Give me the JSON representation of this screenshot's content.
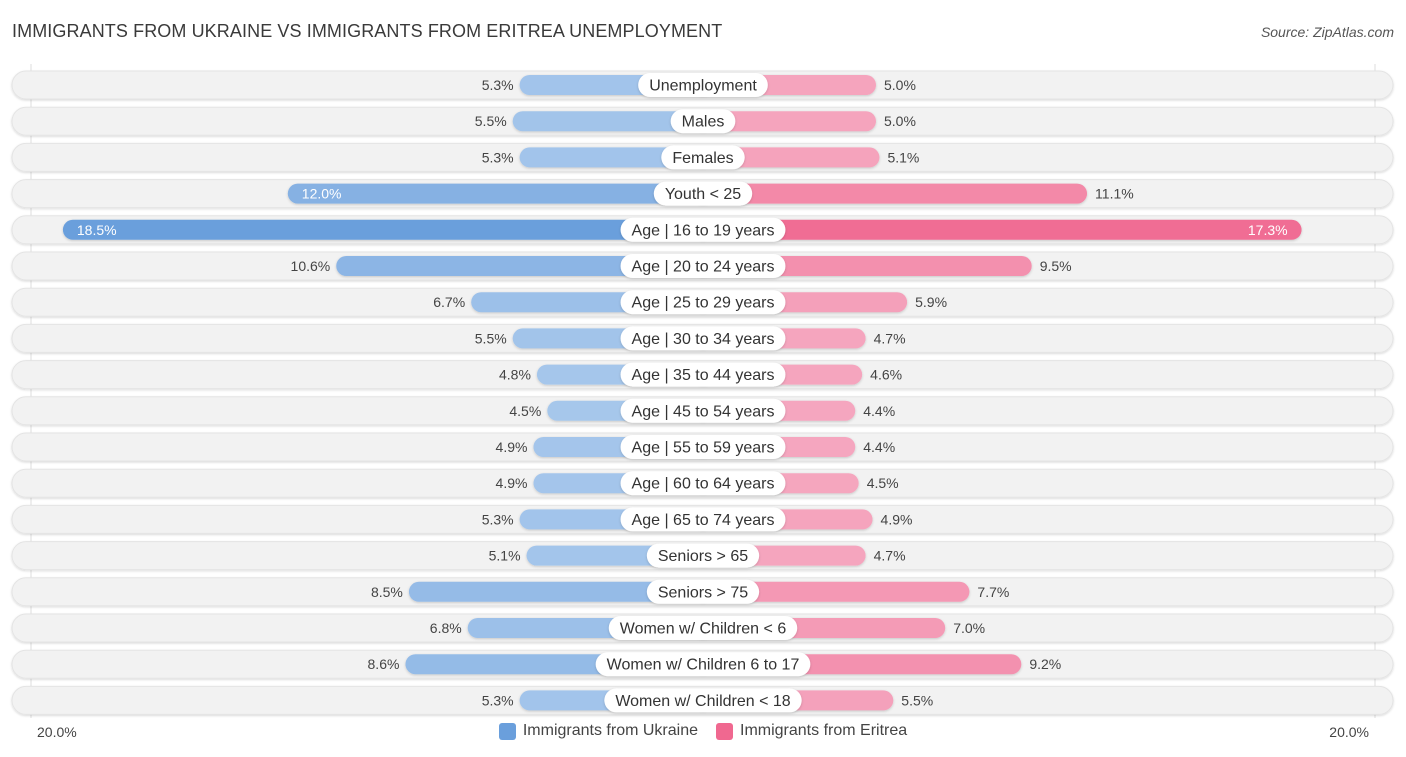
{
  "header": {
    "title": "IMMIGRANTS FROM UKRAINE VS IMMIGRANTS FROM ERITREA UNEMPLOYMENT",
    "source": "Source: ZipAtlas.com"
  },
  "colors": {
    "ukraine_light": "#a8c8ec",
    "ukraine_strong": "#6a9fdc",
    "eritrea_light": "#f5a8c0",
    "eritrea_strong": "#f06890",
    "track": "#f2f2f2"
  },
  "chart_data": {
    "type": "bar",
    "orientation": "horizontal-diverging",
    "title": "IMMIGRANTS FROM UKRAINE VS IMMIGRANTS FROM ERITREA UNEMPLOYMENT",
    "xlabel": "",
    "ylabel": "",
    "xlim": [
      -20.0,
      20.0
    ],
    "axis_labels": {
      "left": "20.0%",
      "right": "20.0%"
    },
    "legend_position": "bottom-center",
    "grid": false,
    "categories": [
      "Unemployment",
      "Males",
      "Females",
      "Youth < 25",
      "Age | 16 to 19 years",
      "Age | 20 to 24 years",
      "Age | 25 to 29 years",
      "Age | 30 to 34 years",
      "Age | 35 to 44 years",
      "Age | 45 to 54 years",
      "Age | 55 to 59 years",
      "Age | 60 to 64 years",
      "Age | 65 to 74 years",
      "Seniors > 65",
      "Seniors > 75",
      "Women w/ Children < 6",
      "Women w/ Children 6 to 17",
      "Women w/ Children < 18"
    ],
    "series": [
      {
        "name": "Immigrants from Ukraine",
        "side": "left",
        "values": [
          5.3,
          5.5,
          5.3,
          12.0,
          18.5,
          10.6,
          6.7,
          5.5,
          4.8,
          4.5,
          4.9,
          4.9,
          5.3,
          5.1,
          8.5,
          6.8,
          8.6,
          5.3
        ],
        "labels": [
          "5.3%",
          "5.5%",
          "5.3%",
          "12.0%",
          "18.5%",
          "10.6%",
          "6.7%",
          "5.5%",
          "4.8%",
          "4.5%",
          "4.9%",
          "4.9%",
          "5.3%",
          "5.1%",
          "8.5%",
          "6.8%",
          "8.6%",
          "5.3%"
        ]
      },
      {
        "name": "Immigrants from Eritrea",
        "side": "right",
        "values": [
          5.0,
          5.0,
          5.1,
          11.1,
          17.3,
          9.5,
          5.9,
          4.7,
          4.6,
          4.4,
          4.4,
          4.5,
          4.9,
          4.7,
          7.7,
          7.0,
          9.2,
          5.5
        ],
        "labels": [
          "5.0%",
          "5.0%",
          "5.1%",
          "11.1%",
          "17.3%",
          "9.5%",
          "5.9%",
          "4.7%",
          "4.6%",
          "4.4%",
          "4.4%",
          "4.5%",
          "4.9%",
          "4.7%",
          "7.7%",
          "7.0%",
          "9.2%",
          "5.5%"
        ]
      }
    ]
  }
}
